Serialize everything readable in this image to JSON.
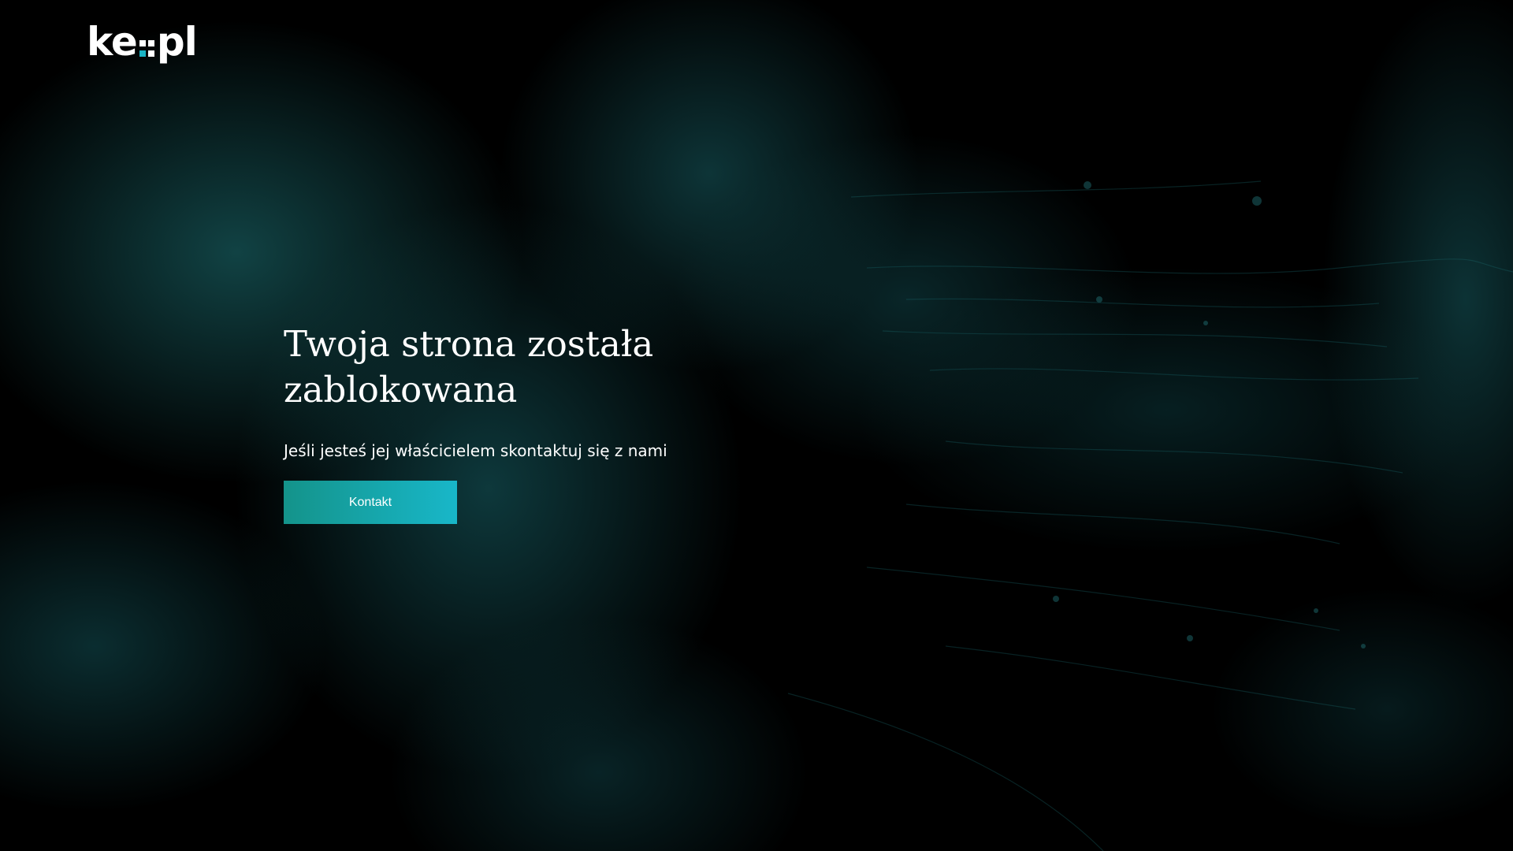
{
  "logo": {
    "text_left": "ke",
    "text_right": "pl",
    "accent_color": "#1ab3c4"
  },
  "main": {
    "headline_line1": "Twoja strona została",
    "headline_line2": "zablokowana",
    "subtext": "Jeśli jesteś jej właścicielem skontaktuj się z nami",
    "button_label": "Kontakt"
  },
  "colors": {
    "background": "#000000",
    "button_gradient_start": "#14938a",
    "button_gradient_end": "#18b7c9"
  }
}
